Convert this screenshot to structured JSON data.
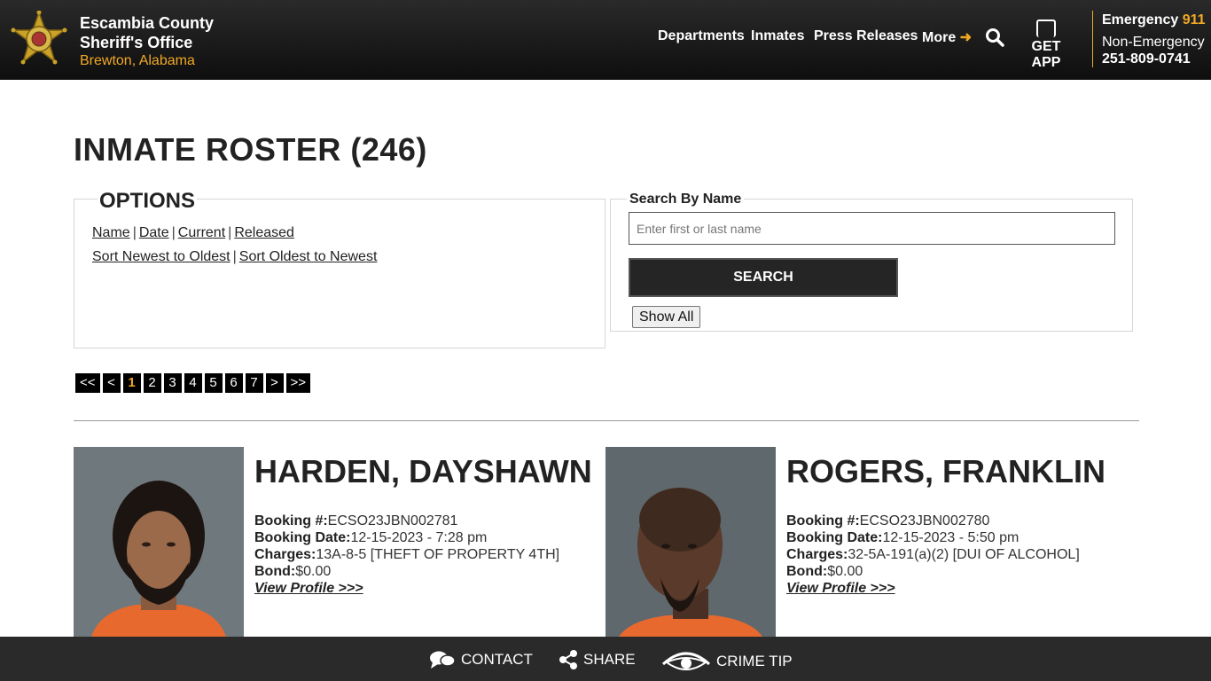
{
  "header": {
    "org_line1": "Escambia County",
    "org_line2": "Sheriff's Office",
    "location": "Brewton, Alabama",
    "nav": [
      {
        "label": "Departments"
      },
      {
        "label": "Inmates"
      },
      {
        "label": "Press Releases"
      },
      {
        "label": "More"
      }
    ],
    "get_app": "GET APP",
    "emergency_label": "Emergency",
    "emergency_number": "911",
    "non_emergency_label": "Non-Emergency",
    "non_emergency_number": "251-809-0741",
    "accent": "#f1a925"
  },
  "main": {
    "title": "INMATE ROSTER (246)",
    "options": {
      "legend": "OPTIONS",
      "sort_links": [
        "Name",
        "Date",
        "Current",
        "Released"
      ],
      "order_links": [
        "Sort Newest to Oldest",
        "Sort Oldest to Newest"
      ]
    },
    "search": {
      "legend": "Search By Name",
      "placeholder": "Enter first or last name",
      "value": "",
      "search_label": "SEARCH",
      "show_all_label": "Show All"
    },
    "pager": {
      "first": "<<",
      "prev": "<",
      "pages": [
        "1",
        "2",
        "3",
        "4",
        "5",
        "6",
        "7"
      ],
      "current": "1",
      "next": ">",
      "last": ">>"
    },
    "inmates": [
      {
        "name": "HARDEN, DAYSHAWN",
        "booking_no_label": "Booking #:",
        "booking_no": "ECSO23JBN002781",
        "booking_date_label": "Booking Date:",
        "booking_date": "12-15-2023 - 7:28 pm",
        "charges_label": "Charges:",
        "charges": "13A-8-5 [THEFT OF PROPERTY 4TH]",
        "bond_label": "Bond:",
        "bond": "$0.00",
        "profile_link": "View Profile >>>"
      },
      {
        "name": "ROGERS, FRANKLIN",
        "booking_no_label": "Booking #:",
        "booking_no": "ECSO23JBN002780",
        "booking_date_label": "Booking Date:",
        "booking_date": "12-15-2023 - 5:50 pm",
        "charges_label": "Charges:",
        "charges": "32-5A-191(a)(2) [DUI OF ALCOHOL]",
        "bond_label": "Bond:",
        "bond": "$0.00",
        "profile_link": "View Profile >>>"
      }
    ]
  },
  "footer": {
    "contact": "CONTACT",
    "share": "SHARE",
    "crime_tip": "CRIME TIP"
  },
  "icons": [
    "sheriff-badge-icon",
    "arrow-right-icon",
    "search-icon",
    "phone-icon",
    "chat-icon",
    "share-icon",
    "eye-icon"
  ]
}
